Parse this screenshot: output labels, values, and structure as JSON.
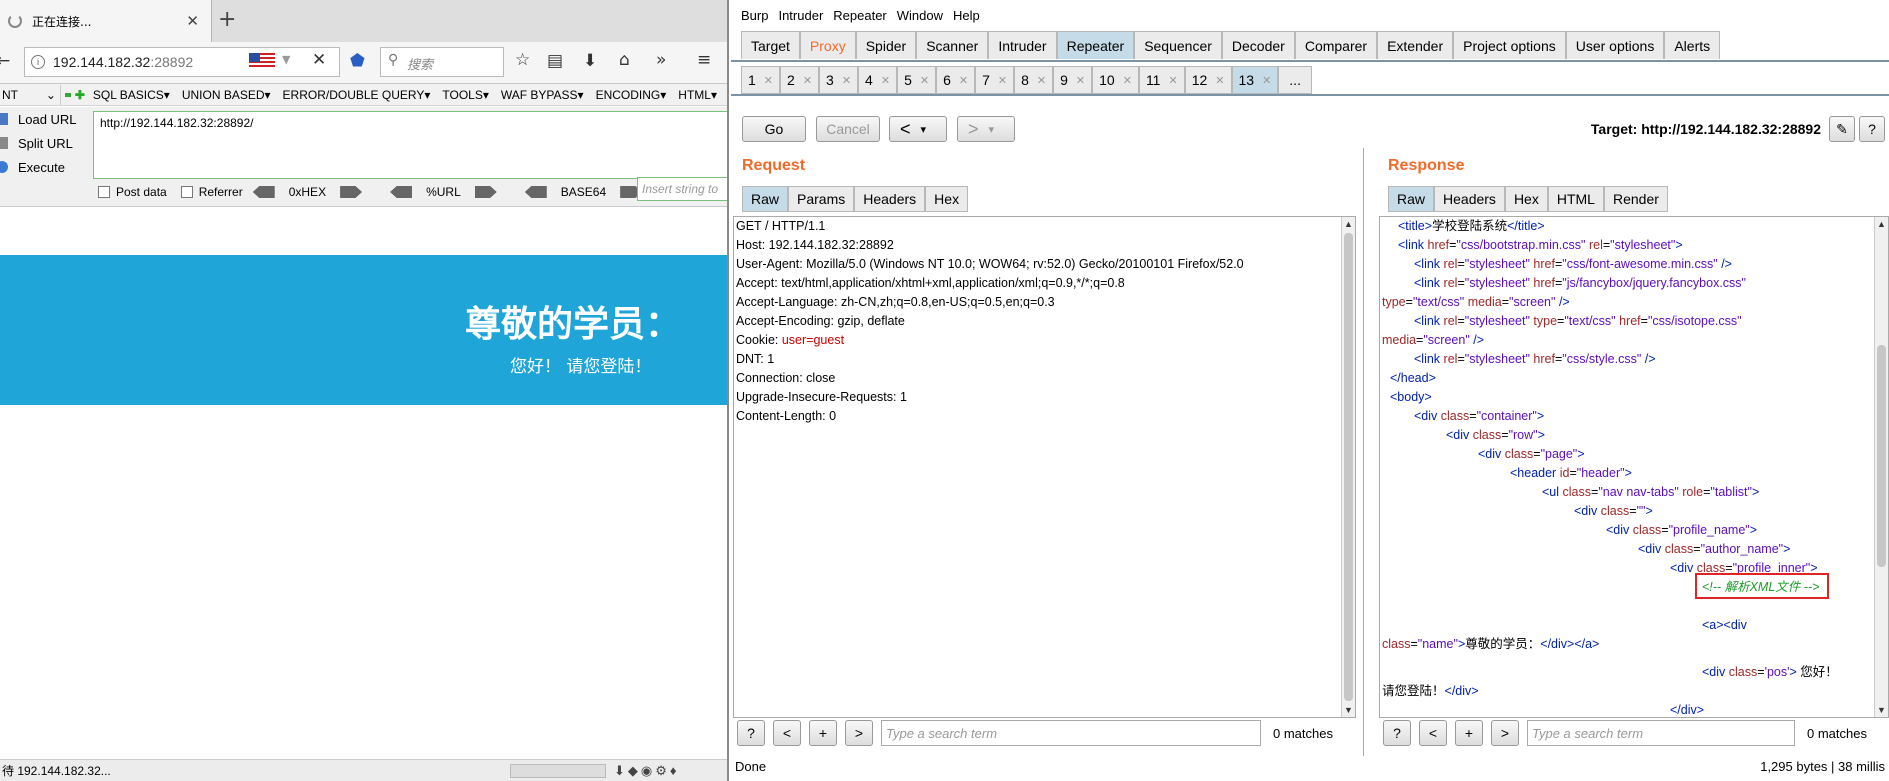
{
  "firefox": {
    "tab_title": "正在连接...",
    "url_host": "192.144.182.32",
    "url_port": ":28892",
    "search_placeholder": "搜索"
  },
  "hackbar": {
    "select_value": "NT",
    "menu": [
      "SQL BASICS▾",
      "UNION BASED▾",
      "ERROR/DOUBLE QUERY▾",
      "TOOLS▾",
      "WAF BYPASS▾",
      "ENCODING▾",
      "HTML▾"
    ],
    "load_url": "Load URL",
    "split_url": "Split URL",
    "execute": "Execute",
    "url_value": "http://192.144.182.32:28892/",
    "post_data": "Post data",
    "referrer": "Referrer",
    "hex": "0xHEX",
    "urlenc": "%URL",
    "base64": "BASE64",
    "insert_placeholder": "Insert string to"
  },
  "page": {
    "banner_title": "尊敬的学员：",
    "banner_sub": "您好！  请您登陆！"
  },
  "status_bar": "待 192.144.182.32...",
  "burp": {
    "menu": [
      "Burp",
      "Intruder",
      "Repeater",
      "Window",
      "Help"
    ],
    "tabs": [
      "Target",
      "Proxy",
      "Spider",
      "Scanner",
      "Intruder",
      "Repeater",
      "Sequencer",
      "Decoder",
      "Comparer",
      "Extender",
      "Project options",
      "User options",
      "Alerts"
    ],
    "subtabs": [
      "1",
      "2",
      "3",
      "4",
      "5",
      "6",
      "7",
      "8",
      "9",
      "10",
      "11",
      "12",
      "13"
    ],
    "more": "...",
    "go": "Go",
    "cancel": "Cancel",
    "back": "<",
    "fwd": ">",
    "dropdown": "▾",
    "target": "Target: http://192.144.182.32:28892",
    "request_label": "Request",
    "response_label": "Response",
    "req_tabs": [
      "Raw",
      "Params",
      "Headers",
      "Hex"
    ],
    "resp_tabs": [
      "Raw",
      "Headers",
      "Hex",
      "HTML",
      "Render"
    ],
    "request_lines": [
      "GET / HTTP/1.1",
      "Host: 192.144.182.32:28892",
      "User-Agent: Mozilla/5.0 (Windows NT 10.0; WOW64; rv:52.0) Gecko/20100101 Firefox/52.0",
      "Accept: text/html,application/xhtml+xml,application/xml;q=0.9,*/*;q=0.8",
      "Accept-Language: zh-CN,zh;q=0.8,en-US;q=0.5,en;q=0.3",
      "Accept-Encoding: gzip, deflate"
    ],
    "cookie_label": "Cookie: ",
    "cookie_value": "user=guest",
    "request_tail": [
      "DNT: 1",
      "Connection: close",
      "Upgrade-Insecure-Requests: 1",
      "Content-Length: 0"
    ],
    "search_placeholder": "Type a search term",
    "matches": "0 matches",
    "help": "?",
    "prev": "<",
    "plus": "+",
    "next": ">",
    "done": "Done",
    "resp_stats": "1,295 bytes | 38 millis",
    "comment": "<!-- 解析XML文件  -->"
  }
}
